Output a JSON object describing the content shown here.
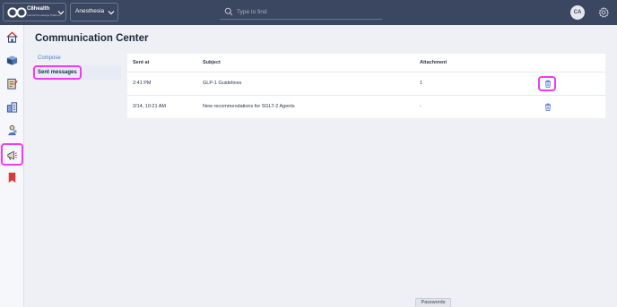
{
  "header": {
    "brand": {
      "name": "C8health",
      "tagline": "Clinical Knowledge Platform",
      "logo_icon": "infinity-logo-icon"
    },
    "department": "Anesthesia",
    "search_placeholder": "Type to find",
    "avatar_initials": "CA",
    "settings_icon": "gear-icon"
  },
  "sidebar": {
    "items": [
      {
        "icon": "home-icon"
      },
      {
        "icon": "book-icon"
      },
      {
        "icon": "checklist-icon"
      },
      {
        "icon": "building-icon"
      },
      {
        "icon": "people-icon"
      },
      {
        "icon": "megaphone-icon",
        "selected": true
      },
      {
        "icon": "bookmark-icon"
      }
    ]
  },
  "main": {
    "title": "Communication Center",
    "subnav": {
      "compose": "Compose",
      "sent": "Sent messages"
    },
    "table": {
      "columns": [
        "Sent at",
        "Subject",
        "Attachment"
      ],
      "rows": [
        {
          "sent_at": "2:41 PM",
          "subject": "GLP-1 Guidelines",
          "attachment": "1"
        },
        {
          "sent_at": "2/14, 10:21 AM",
          "subject": "New recommendations for SGLT-2 Agents",
          "attachment": "-"
        }
      ]
    }
  },
  "footer": {
    "passwords_label": "Passwords"
  },
  "colors": {
    "topbar": "#3b4660",
    "highlight": "#f03bf0",
    "accent": "#4f7cc4",
    "trash": "#4a6fd1"
  }
}
